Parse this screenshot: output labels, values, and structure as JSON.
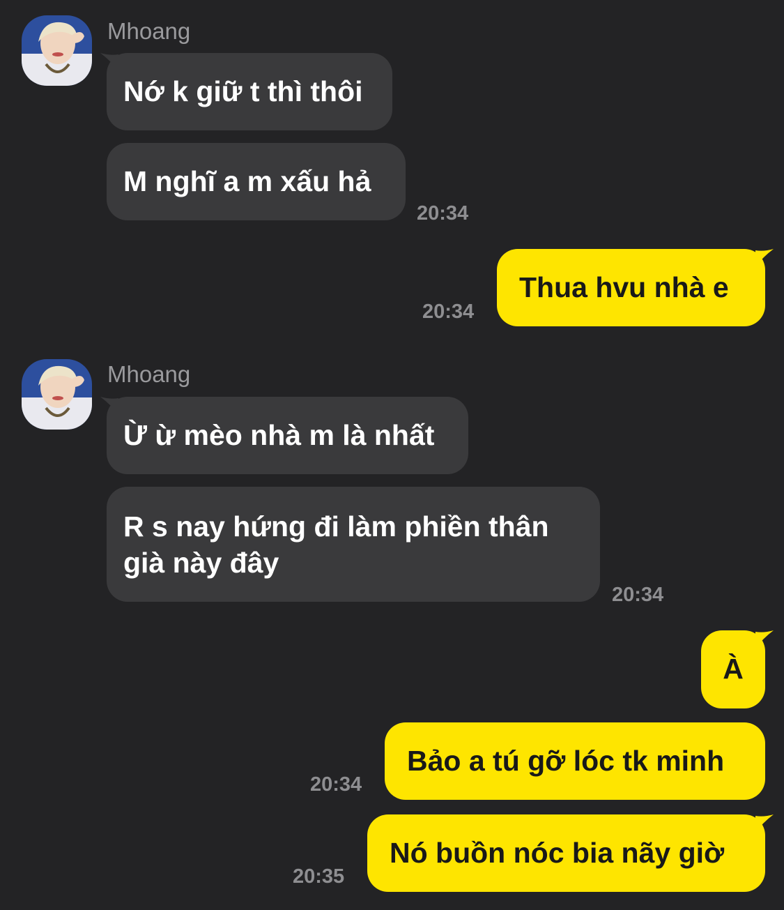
{
  "chat": {
    "groups": [
      {
        "sender": "Mhoang",
        "messages": [
          "Nớ k giữ t thì thôi",
          "M nghĩ a m xấu hả"
        ],
        "time": "20:34"
      },
      {
        "outgoing": [
          "Thua hvu nhà e"
        ],
        "time": "20:34"
      },
      {
        "sender": "Mhoang",
        "messages": [
          "Ừ ừ mèo nhà m là nhất",
          "R s nay hứng đi làm phiền thân\ngià này đây"
        ],
        "time": "20:34"
      },
      {
        "outgoing": [
          "À",
          "Bảo a tú gỡ lóc tk minh"
        ],
        "time": "20:34"
      },
      {
        "outgoing": [
          "Nó buồn nóc bia nãy giờ"
        ],
        "time": "20:35"
      }
    ]
  },
  "colors": {
    "background": "#232325",
    "incoming_bubble": "#3a3a3c",
    "outgoing_bubble": "#fee500",
    "timestamp": "#8e8e91"
  }
}
